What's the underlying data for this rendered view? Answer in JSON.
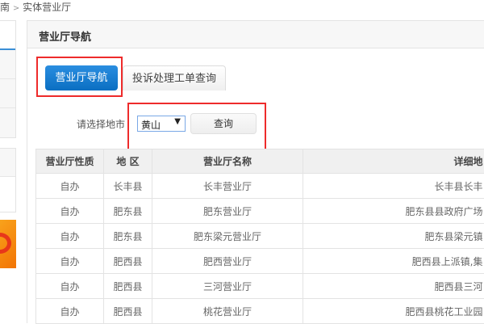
{
  "breadcrumb": {
    "prev": "南",
    "sep": ">",
    "current": "实体营业厅"
  },
  "panel": {
    "title": "营业厅导航"
  },
  "tabs": [
    {
      "label": "营业厅导航",
      "active": true
    },
    {
      "label": "投诉处理工单查询",
      "active": false
    }
  ],
  "filter": {
    "label": "请选择地市",
    "city": "黄山",
    "query_button": "查询"
  },
  "table": {
    "headers": [
      "营业厅性质",
      "地 区",
      "营业厅名称",
      "详细地"
    ],
    "rows": [
      [
        "自办",
        "长丰县",
        "长丰营业厅",
        "长丰县长丰"
      ],
      [
        "自办",
        "肥东县",
        "肥东营业厅",
        "肥东县县政府广场"
      ],
      [
        "自办",
        "肥东县",
        "肥东梁元营业厅",
        "肥东县梁元镇"
      ],
      [
        "自办",
        "肥西县",
        "肥西营业厅",
        "肥西县上派镇,集"
      ],
      [
        "自办",
        "肥西县",
        "三河营业厅",
        "肥西县三河"
      ],
      [
        "自办",
        "肥西县",
        "桃花营业厅",
        "肥西县桃花工业园"
      ]
    ]
  },
  "colors": {
    "accent": "#0a6fc2",
    "highlight": "#ee2b2b"
  }
}
